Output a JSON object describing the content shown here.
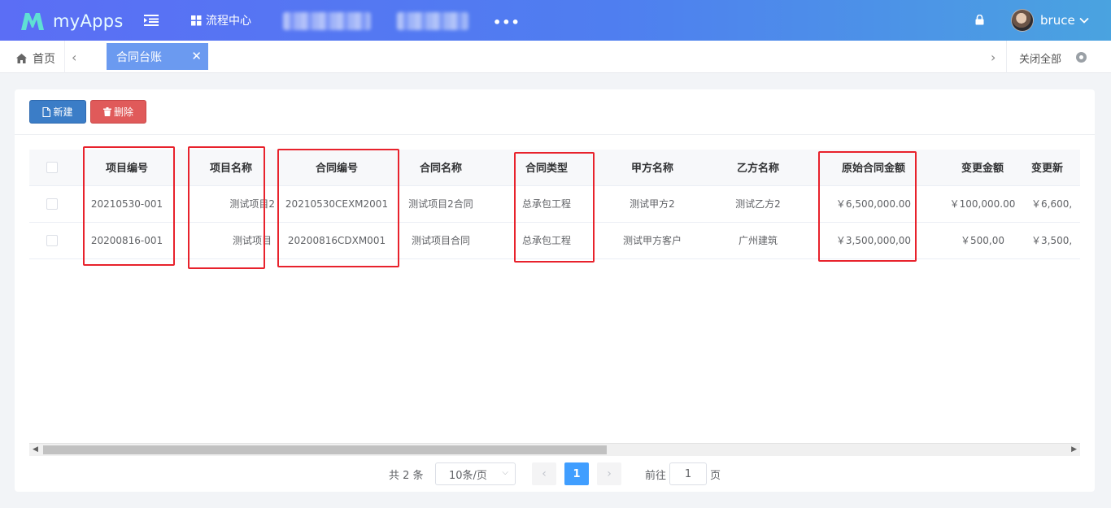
{
  "app": {
    "logo_text": "myApps",
    "nav": {
      "process_center": "流程中心",
      "more": "•••"
    },
    "user": {
      "name": "bruce"
    }
  },
  "tabs": {
    "home": "首页",
    "active": "合同台账",
    "close_all": "关闭全部"
  },
  "toolbar": {
    "new_label": "新建",
    "delete_label": "删除"
  },
  "table": {
    "columns": [
      "项目编号",
      "项目名称",
      "合同编号",
      "合同名称",
      "合同类型",
      "甲方名称",
      "乙方名称",
      "原始合同金额",
      "变更金额",
      "变更新"
    ],
    "rows": [
      [
        "20210530-001",
        "测试项目2",
        "20210530CEXM2001",
        "测试项目2合同",
        "总承包工程",
        "测试甲方2",
        "测试乙方2",
        "￥6,500,000.00",
        "￥100,000.00",
        "￥6,600,"
      ],
      [
        "20200816-001",
        "测试项目",
        "20200816CDXM001",
        "测试项目合同",
        "总承包工程",
        "测试甲方客户",
        "广州建筑",
        "￥3,500,000,00",
        "￥500,00",
        "￥3,500,"
      ]
    ]
  },
  "pagination": {
    "total": "共 2 条",
    "page_size": "10条/页",
    "current_page": "1",
    "goto_label": "前往",
    "goto_value": "1",
    "page_suffix": "页"
  },
  "colors": {
    "header_gradient_start": "#5b6ef5",
    "header_gradient_end": "#4aa3e0",
    "active_tab": "#6b9af0",
    "new_button": "#3b7dc7",
    "delete_button": "#e05a5a",
    "highlight_box": "#e8222c",
    "current_page": "#409eff"
  }
}
